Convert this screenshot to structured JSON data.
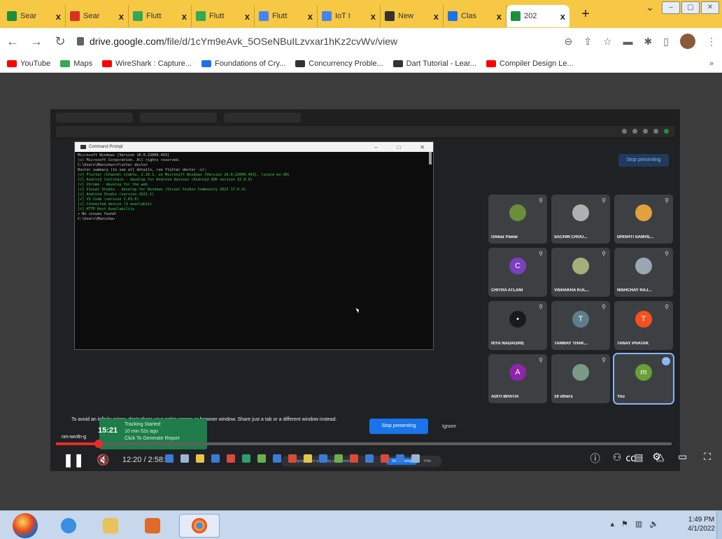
{
  "browser": {
    "tabs": [
      {
        "label": "Sear",
        "color": "#1e8e3e"
      },
      {
        "label": "Sear",
        "color": "#d93025"
      },
      {
        "label": "Flutt",
        "color": "#34a853"
      },
      {
        "label": "Flutt",
        "color": "#34a853"
      },
      {
        "label": "Flutt",
        "color": "#4285f4"
      },
      {
        "label": "IoT I",
        "color": "#4285f4"
      },
      {
        "label": "New",
        "color": "#333333"
      },
      {
        "label": "Clas",
        "color": "#1a73e8"
      },
      {
        "label": "202",
        "color": "#1e8e3e"
      }
    ],
    "close_glyph": "x",
    "new_tab": "+",
    "url_domain": "drive.google.com",
    "url_path": "/file/d/1cYm9eAvk_5OSeNBuILzvxar1hKz2cvWv/view",
    "bookmarks": [
      {
        "label": "YouTube",
        "color": "#ff0000"
      },
      {
        "label": "Maps",
        "color": "#34a853"
      },
      {
        "label": "WireShark : Capture...",
        "color": "#ff0000"
      },
      {
        "label": "Foundations of Cry...",
        "color": "#1a73e8"
      },
      {
        "label": "Concurrency Proble...",
        "color": "#333333"
      },
      {
        "label": "Dart Tutorial - Lear...",
        "color": "#333333"
      },
      {
        "label": "Compiler Design Le...",
        "color": "#ff0000"
      }
    ],
    "bookmarks_more": "»"
  },
  "cmd": {
    "title": "Command Prompt",
    "lines": [
      "Microsoft Windows [Version 10.0.22000.493]",
      "(c) Microsoft Corporation. All rights reserved.",
      "",
      "C:\\Users\\Manishar>flutter doctor",
      "Doctor summary (to see all details, run flutter doctor -v):",
      "[√] Flutter (Channel stable, 2.10.1, on Microsoft Windows [Version 10.0.22000.493], locale en-IN)",
      "[√] Android toolchain - develop for Android devices (Android SDK version 32.0.0)",
      "[√] Chrome - develop for the web",
      "[√] Visual Studio - develop for Windows (Visual Studio Community 2022 17.0.4)",
      "[√] Android Studio (version 2021.1)",
      "[√] VS Code (version 1.63.0)",
      "[√] Connected device (3 available)",
      "[√] HTTP Host Availability",
      "",
      "• No issues found!",
      "",
      "C:\\Users\\Manisha>"
    ]
  },
  "meet": {
    "stop_presenting_top": "Stop presenting",
    "participants": [
      {
        "name": "Omkar Pawar",
        "color": "#6b8e3a",
        "initial": ""
      },
      {
        "name": "SACHIN CHOU...",
        "color": "#b0b0b0",
        "initial": ""
      },
      {
        "name": "DRISHTI SAMVE...",
        "color": "#e2a13a",
        "initial": ""
      },
      {
        "name": "CHITRA ATLANI",
        "color": "#7b3fbf",
        "initial": "C"
      },
      {
        "name": "VISHAKHA KUL...",
        "color": "#a3b07a",
        "initial": ""
      },
      {
        "name": "NISHCHAY RAJ...",
        "color": "#9aa6b2",
        "initial": ""
      },
      {
        "name": "RIYA NADAGIRE",
        "color": "#1a1a1a",
        "initial": "•"
      },
      {
        "name": "TANMAY THAK...",
        "color": "#607d8b",
        "initial": "T"
      },
      {
        "name": "TANAY PHATAK",
        "color": "#f4511e",
        "initial": "T"
      },
      {
        "name": "ADITI BHATIA",
        "color": "#8e24aa",
        "initial": "A"
      },
      {
        "name": "19 others",
        "color": "#7a9a88",
        "initial": ""
      },
      {
        "name": "You",
        "color": "#689f38",
        "initial": "m"
      }
    ],
    "warning": "To avoid an infinity mirror, don't share your entire screen or browser window. Share just a tab or a different window instead.",
    "warning_stop": "Stop presenting",
    "warning_ignore": "Ignore",
    "sharing_notice": "meet.google.com is sharing your screen.",
    "stop_sharing": "Stop sharing",
    "hide": "Hide"
  },
  "overlay": {
    "time": "15:21",
    "status": "Tracking Started",
    "ago": "10 min 52s ago",
    "action": "Click To Generate Report",
    "left_label": "nm-wmfn-g"
  },
  "video": {
    "time_display": "12:20 / 2:58:52",
    "progress_fraction": 0.069
  },
  "taskbar": {
    "time": "1:49 PM",
    "date": "4/1/2022"
  }
}
